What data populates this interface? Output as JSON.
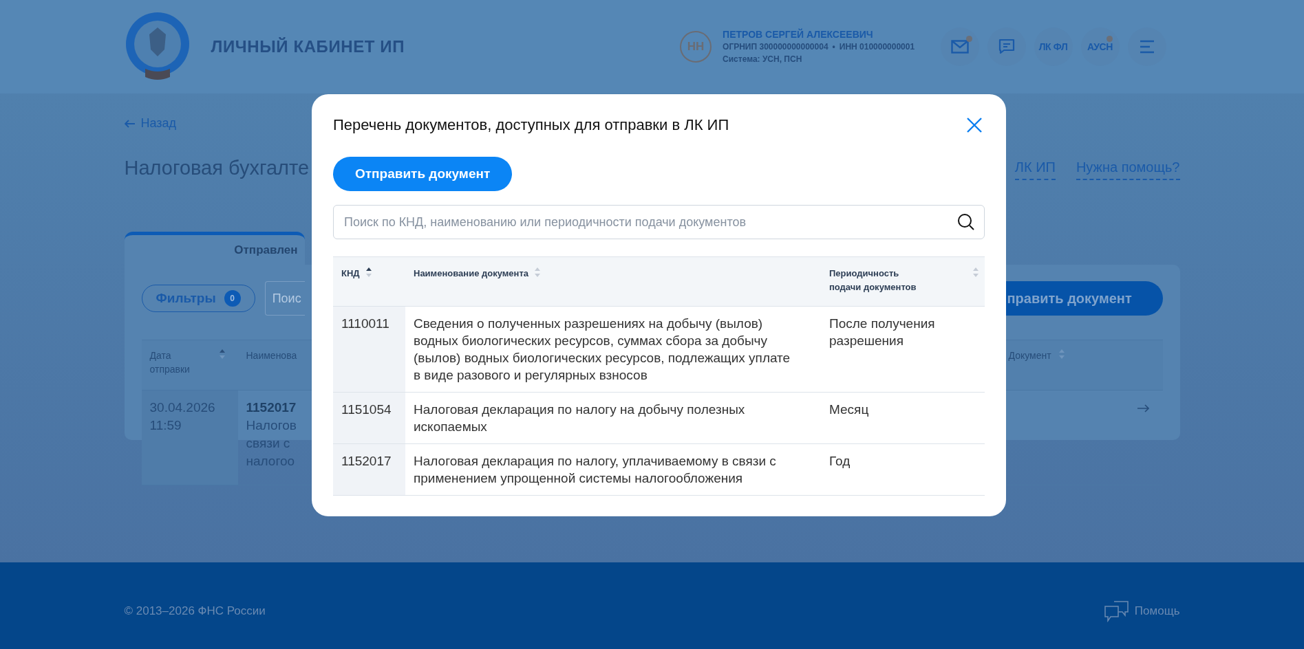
{
  "header": {
    "title": "ЛИЧНЫЙ КАБИНЕТ ИП",
    "avatar_initials": "НН",
    "user_name": "ПЕТРОВ СЕРГЕЙ АЛЕКСЕЕВИЧ",
    "ogrnip": "ОГРНИП 300000000000004",
    "separator": "•",
    "inn": "ИНН 010000000001",
    "system": "Система: УСН, ПСН",
    "actions": [
      {
        "kind": "mail",
        "badge": true
      },
      {
        "kind": "chat",
        "badge": false
      },
      {
        "kind": "text",
        "label": "ЛК ФЛ",
        "badge": false
      },
      {
        "kind": "text",
        "label": "АУСН",
        "badge": true
      },
      {
        "kind": "menu",
        "badge": false
      }
    ]
  },
  "page": {
    "back": "Назад",
    "title": "Налоговая бухгалте",
    "links": [
      "ЛК ИП",
      "Нужна помощь?"
    ],
    "tab": {
      "label": "Отправлен",
      "selected": true
    },
    "filters": {
      "label": "Фильтры",
      "count": "0"
    },
    "search": {
      "placeholder": "Поис"
    },
    "send_button": "править документ",
    "table": {
      "columns": [
        {
          "label": "Дата отправки",
          "sorted": true
        },
        {
          "label": "Наименова"
        },
        {
          "label": "Документ",
          "sorted": false
        }
      ],
      "rows": [
        {
          "date": "30.04.2026",
          "time": "11:59",
          "knd": "1152017",
          "name_lines": [
            "Налогов",
            "связи с",
            "налогоо"
          ]
        }
      ]
    }
  },
  "modal": {
    "title": "Перечень документов, доступных для отправки в ЛК ИП",
    "send_button": "Отправить документ",
    "search": {
      "placeholder": "Поиск по КНД, наименованию или периодичности подачи документов"
    },
    "table": {
      "columns": [
        {
          "label": "КНД",
          "sorted": true
        },
        {
          "label": "Наименование документа",
          "sorted": false
        },
        {
          "label": "Периодичность подачи документов",
          "sorted": false
        }
      ],
      "rows": [
        {
          "knd": "1110011",
          "name": "Сведения о полученных разрешениях на добычу (вылов) водных биологических ресурсов, суммах сбора за добычу (вылов) водных биологических ресурсов, подлежащих уплате в виде разового и регулярных взносов",
          "period": "После получения разрешения"
        },
        {
          "knd": "1151054",
          "name": "Налоговая декларация по налогу на добычу полезных ископаемых",
          "period": "Месяц"
        },
        {
          "knd": "1152017",
          "name": "Налоговая декларация по налогу, уплачиваемому в связи с применением упрощенной системы налогообложения",
          "period": "Год"
        }
      ]
    }
  },
  "footer": {
    "copyright": "© 2013–2026 ФНС России",
    "help": "Помощь"
  }
}
